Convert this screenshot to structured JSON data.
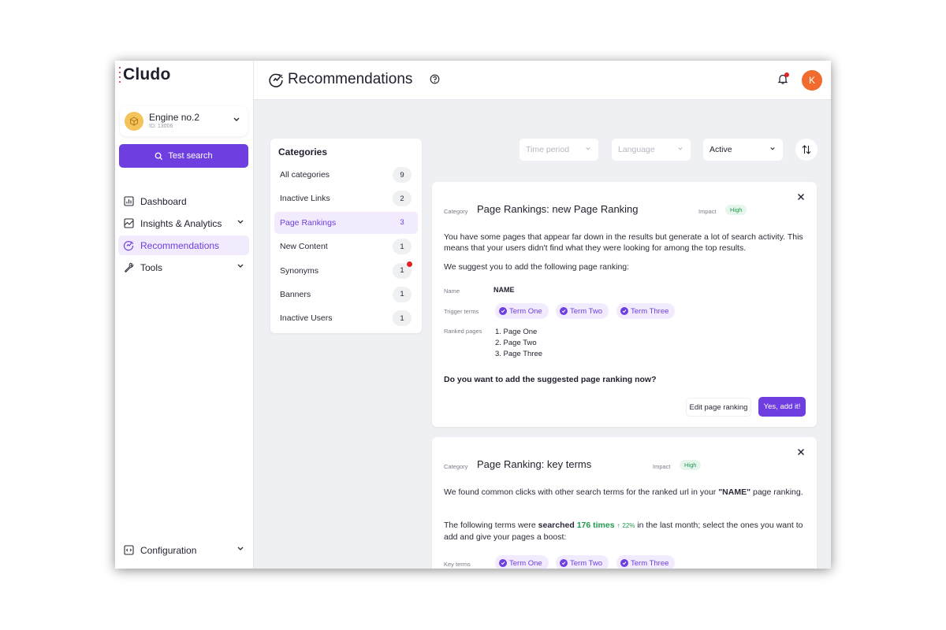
{
  "app": {
    "logo": "Cludo"
  },
  "engine": {
    "name": "Engine no.2",
    "id": "ID: 13006"
  },
  "sidebar": {
    "test_search": "Test search",
    "items": [
      {
        "label": "Dashboard",
        "icon": "chart-icon"
      },
      {
        "label": "Insights & Analytics",
        "icon": "analytics-icon",
        "has_chevron": true
      },
      {
        "label": "Recommendations",
        "icon": "recommendations-icon",
        "active": true
      },
      {
        "label": "Tools",
        "icon": "wrench-icon",
        "has_chevron": true
      }
    ],
    "config": "Configuration"
  },
  "header": {
    "title": "Recommendations",
    "avatar": "K"
  },
  "categories": {
    "title": "Categories",
    "items": [
      {
        "label": "All categories",
        "count": "9"
      },
      {
        "label": "Inactive Links",
        "count": "2"
      },
      {
        "label": "Page Rankings",
        "count": "3",
        "active": true
      },
      {
        "label": "New Content",
        "count": "1"
      },
      {
        "label": "Synonyms",
        "count": "1",
        "notification": true
      },
      {
        "label": "Banners",
        "count": "1"
      },
      {
        "label": "Inactive Users",
        "count": "1"
      }
    ]
  },
  "filters": {
    "time_period": "Time period",
    "language": "Language",
    "status": "Active"
  },
  "card1": {
    "category_label": "Category",
    "title": "Page Rankings: new Page Ranking",
    "impact_label": "Impact",
    "impact": "High",
    "text1": "You have some pages that appear far down in the results but generate a lot of search activity. This means that your users didn't find what they were looking for among the top results.",
    "text2": "We suggest you to add the following page ranking:",
    "name_label": "Name",
    "name_value": "NAME",
    "trigger_label": "Trigger terms",
    "terms": [
      "Term One",
      "Term Two",
      "Term Three"
    ],
    "ranked_label": "Ranked pages",
    "ranked_pages": [
      "1. Page One",
      "2. Page Two",
      "3. Page Three"
    ],
    "question": "Do you want to add the suggested page ranking now?",
    "edit_button": "Edit page ranking",
    "yes_button": "Yes, add it!"
  },
  "card2": {
    "category_label": "Category",
    "title": "Page Ranking: key terms",
    "impact_label": "Impact",
    "impact": "High",
    "text1_a": "We found common clicks with other search terms for the ranked url in your ",
    "text1_b": "\"NAME\"",
    "text1_c": " page ranking.",
    "text2_a": "The following terms were ",
    "text2_b": "searched",
    "text2_c": "176 times",
    "text2_pct": "22%",
    "text2_d": " in the last month; select the ones you want to add and give your pages a boost:",
    "key_label": "Key terms",
    "terms": [
      "Term One",
      "Term Two",
      "Term Three"
    ]
  },
  "colors": {
    "accent": "#6e3ee0",
    "accent_light": "#f1ebfd",
    "success": "#1f9a4f",
    "avatar": "#f26b2e",
    "alert": "#e02424"
  }
}
